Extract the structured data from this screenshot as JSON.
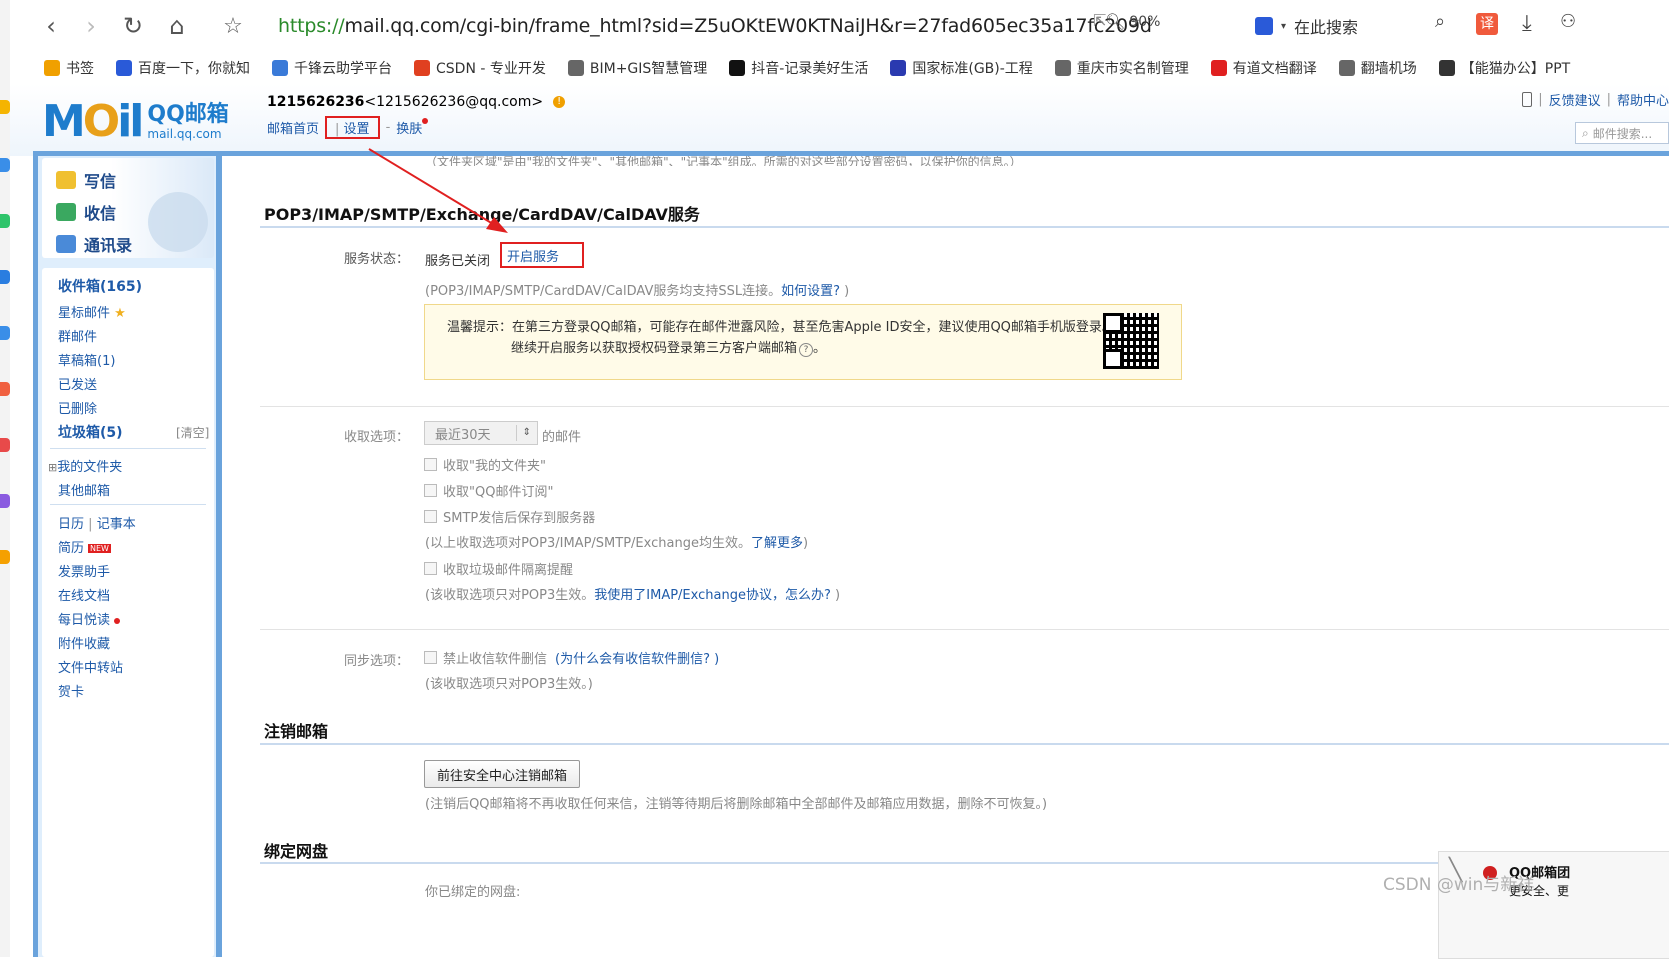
{
  "browser": {
    "url_scheme": "https://",
    "url_rest": "mail.qq.com/cgi-bin/frame_html?sid=Z5uOKtEW0KTNaiJH&r=27fad605ec35a17fc209d",
    "zoom": "90%",
    "search_label": "在此搜索",
    "translate_label": "译"
  },
  "bookmarks": [
    {
      "label": "书签",
      "icon": "star-icon",
      "color": "#f0a000"
    },
    {
      "label": "百度一下，你就知",
      "icon": "baidu-icon",
      "color": "#2a5ad8"
    },
    {
      "label": "千锋云助学平台",
      "icon": "qianfeng-icon",
      "color": "#3a7ad8"
    },
    {
      "label": "CSDN - 专业开发",
      "icon": "csdn-icon",
      "color": "#e04020"
    },
    {
      "label": "BIM+GIS智慧管理",
      "icon": "globe-icon",
      "color": "#666666"
    },
    {
      "label": "抖音-记录美好生活",
      "icon": "douyin-icon",
      "color": "#111111"
    },
    {
      "label": "国家标准(GB)-工程",
      "icon": "gb-icon",
      "color": "#2a3ab0"
    },
    {
      "label": "重庆市实名制管理",
      "icon": "globe-icon",
      "color": "#666666"
    },
    {
      "label": "有道文档翻译",
      "icon": "youdao-icon",
      "color": "#e02020"
    },
    {
      "label": "翻墙机场",
      "icon": "globe-icon",
      "color": "#666666"
    },
    {
      "label": "【能猫办公】PPT",
      "icon": "panda-icon",
      "color": "#333333"
    }
  ],
  "mail": {
    "logo_big": "MOil",
    "logo_cn": "QQ邮箱",
    "logo_domain": "mail.qq.com",
    "account_id": "1215626236",
    "account_email": "<1215626236@qq.com>",
    "nav_home": "邮箱首页",
    "nav_settings": "设置",
    "nav_skin": "换肤",
    "link_feedback": "反馈建议",
    "link_help": "帮助中心",
    "search_placeholder": "邮件搜索..."
  },
  "sidebar": {
    "write": "写信",
    "receive": "收信",
    "contacts": "通讯录",
    "inbox": "收件箱(165)",
    "starred": "星标邮件",
    "group": "群邮件",
    "drafts": "草稿箱(1)",
    "sent": "已发送",
    "deleted": "已删除",
    "spam": "垃圾箱(5)",
    "spam_clear": "[清空]",
    "my_folders": "我的文件夹",
    "other_mailbox": "其他邮箱",
    "calendar": "日历",
    "calendar_sep": "|",
    "notebook": "记事本",
    "resume": "简历",
    "resume_badge": "NEW",
    "invoice": "发票助手",
    "online_docs": "在线文档",
    "daily_read": "每日悦读",
    "attachments": "附件收藏",
    "transfer": "文件中转站",
    "greeting_card": "贺卡"
  },
  "content": {
    "top_cut_text": "（文件夹区域\"是由\"我的文件夹\"、\"其他邮箱\"、\"记事本\"组成。所需的对这些部分设置密码，以保护你的信息。）",
    "section_title": "POP3/IMAP/SMTP/Exchange/CardDAV/CalDAV服务",
    "status_label": "服务状态：",
    "status_value": "服务已关闭",
    "open_service": "开启服务",
    "ssl_note_prefix": "(POP3/IMAP/SMTP/CardDAV/CalDAV服务均支持SSL连接。",
    "ssl_note_link": "如何设置?",
    "ssl_note_suffix": " )",
    "tip_line1": "温馨提示：在第三方登录QQ邮箱，可能存在邮件泄露风险，甚至危害Apple ID安全，建议使用QQ邮箱手机版登录。",
    "tip_line2": "继续开启服务以获取授权码登录第三方客户端邮箱",
    "receive_label": "收取选项：",
    "receive_select": "最近30天",
    "receive_suffix": "的邮件",
    "cb_my_folders": "收取\"我的文件夹\"",
    "cb_subscriptions": "收取\"QQ邮件订阅\"",
    "cb_smtp_save": "SMTP发信后保存到服务器",
    "note_receive_prefix": "(以上收取选项对POP3/IMAP/SMTP/Exchange均生效。",
    "note_receive_link": "了解更多",
    "note_receive_suffix": ")",
    "cb_spam": "收取垃圾邮件隔离提醒",
    "note_pop3_prefix": "(该收取选项只对POP3生效。",
    "note_pop3_link": "我使用了IMAP/Exchange协议，怎么办?",
    "note_pop3_suffix": " )",
    "sync_label": "同步选项：",
    "cb_no_delete": "禁止收信软件删信",
    "cb_no_delete_link": "(为什么会有收信软件删信? )",
    "note_sync": "(该收取选项只对POP3生效。)",
    "cancel_title": "注销邮箱",
    "cancel_button": "前往安全中心注销邮箱",
    "cancel_note": "(注销后QQ邮箱将不再收取任何来信，注销等待期后将删除邮箱中全部邮件及邮箱应用数据，删除不可恢复。)",
    "netdisk_title": "绑定网盘",
    "netdisk_label": "你已绑定的网盘:"
  },
  "overlay": {
    "watermark": "CSDN @win与新祥",
    "notif_title": "QQ邮箱团",
    "notif_sub": "更安全、更"
  }
}
